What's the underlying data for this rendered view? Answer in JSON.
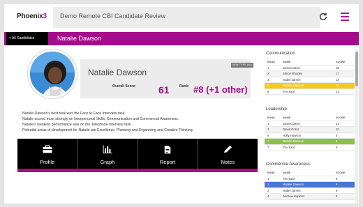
{
  "topbar": {
    "logo_main": "Phoenix",
    "logo_accent": "3",
    "app_title": "Demo Remote CBI Candidate Review",
    "refresh_icon": "refresh-icon",
    "menu_icon": "hamburger-menu-icon"
  },
  "header": {
    "back_label": "< All Candidates",
    "candidate_name": "Natalie Dawson"
  },
  "profile": {
    "badge": "NEW TYPE AVA",
    "name": "Natalie Dawson",
    "overall_score_label": "Overall Score:",
    "overall_score": "61",
    "rank_label": "Rank:",
    "rank_value": "#8 (+1 other)"
  },
  "summary": [
    "Natalie Dawson's best task was the Face to Face Interview task.",
    "Natalie scored most strongly on Interpersonal Skills, Communication and Commercial Awareness.",
    "Natalie's weakest performance was on the Telephone Interview task.",
    "Potential areas of development for Natalie are Excellence, Planning and Organising and Creative Thinking."
  ],
  "tiles": [
    {
      "label": "Profile",
      "icon": "briefcase-icon"
    },
    {
      "label": "Graph",
      "icon": "bar-chart-icon"
    },
    {
      "label": "Report",
      "icon": "document-icon"
    },
    {
      "label": "Notes",
      "icon": "pencil-icon"
    }
  ],
  "leaderboards": {
    "headers": {
      "rank": "RANK",
      "name": "NAME",
      "score": "SCORE"
    },
    "communication": {
      "title": "Communication",
      "rows": [
        {
          "rank": "1",
          "name": "James Davis",
          "score": "18"
        },
        {
          "rank": "2",
          "name": "Simon Rhodes",
          "score": "17"
        },
        {
          "rank": "4",
          "name": "Isabel Jarmin",
          "score": "14"
        },
        {
          "rank": "5",
          "name": "Natalie Dawson",
          "score": "11"
        },
        {
          "rank": "5",
          "name": "Tim Saul",
          "score": "11"
        }
      ]
    },
    "leadership": {
      "title": "Leadership",
      "rows": [
        {
          "rank": "1",
          "name": "James Davis",
          "score": "12"
        },
        {
          "rank": "2",
          "name": "David Grant",
          "score": "10"
        },
        {
          "rank": "6",
          "name": "Holly Howson",
          "score": "6"
        },
        {
          "rank": "7",
          "name": "Natalie Dawson",
          "score": "5"
        },
        {
          "rank": "7",
          "name": "Tim Saul",
          "score": "5"
        }
      ]
    },
    "commercial": {
      "title": "Commercial Awareness",
      "rows": [
        {
          "rank": "1",
          "name": "Tim Saul",
          "score": "9"
        },
        {
          "rank": "1",
          "name": "Natalie Dawson",
          "score": "9"
        },
        {
          "rank": "3",
          "name": "Isabel Jarmin",
          "score": "9"
        },
        {
          "rank": "4",
          "name": "Andrew Hopkins",
          "score": "8"
        }
      ]
    }
  },
  "colors": {
    "brand": "#a50b8a",
    "highlight_yellow": "#f5c81f",
    "highlight_green": "#8cc04a",
    "highlight_blue": "#4a76d4"
  }
}
